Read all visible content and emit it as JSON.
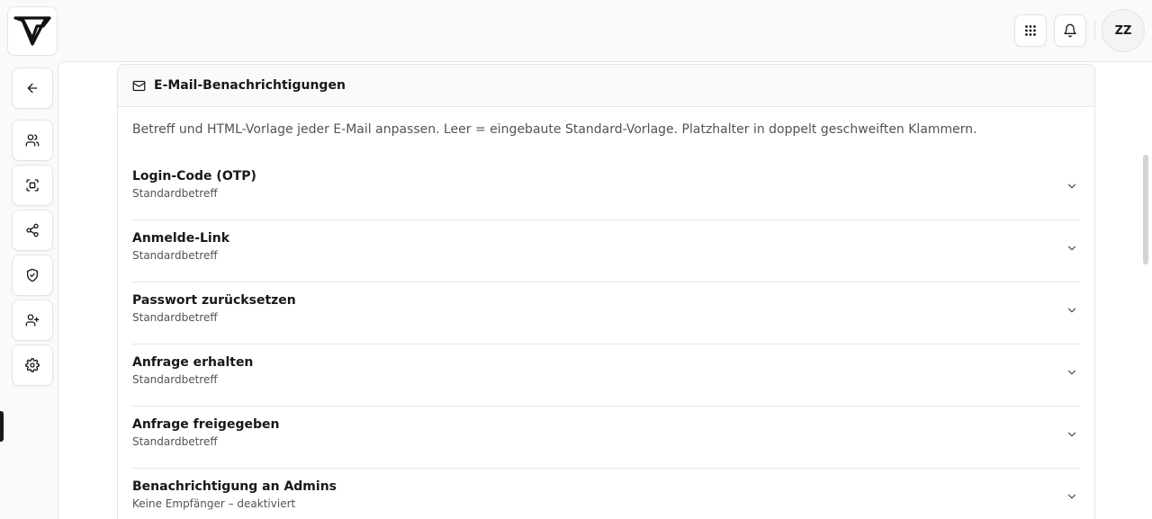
{
  "header": {
    "avatar_initials": "ZZ",
    "icons": [
      "apps-grid-icon",
      "bell-icon"
    ]
  },
  "sidebar": {
    "items": [
      {
        "name": "back",
        "icon": "arrow-left-icon"
      },
      {
        "name": "users",
        "icon": "users-icon"
      },
      {
        "name": "scan",
        "icon": "scan-face-icon"
      },
      {
        "name": "share",
        "icon": "share-icon"
      },
      {
        "name": "security",
        "icon": "shield-check-icon"
      },
      {
        "name": "add-user",
        "icon": "user-plus-icon"
      },
      {
        "name": "settings",
        "icon": "gear-icon",
        "active": true
      }
    ]
  },
  "card": {
    "title": "E-Mail-Benachrichtigungen",
    "title_icon": "mail-icon",
    "description": "Betreff und HTML-Vorlage jeder E-Mail anpassen. Leer = eingebaute Standard-Vorlage. Platzhalter in doppelt geschweiften Klammern.",
    "templates": [
      {
        "title": "Login-Code (OTP)",
        "subtitle": "Standardbetreff"
      },
      {
        "title": "Anmelde-Link",
        "subtitle": "Standardbetreff"
      },
      {
        "title": "Passwort zurücksetzen",
        "subtitle": "Standardbetreff"
      },
      {
        "title": "Anfrage erhalten",
        "subtitle": "Standardbetreff"
      },
      {
        "title": "Anfrage freigegeben",
        "subtitle": "Standardbetreff"
      },
      {
        "title": "Benachrichtigung an Admins",
        "subtitle": "Keine Empfänger – deaktiviert"
      }
    ]
  },
  "colors": {
    "background": "#fafafa",
    "border": "#e4e4e7",
    "text": "#18181b",
    "muted": "#52525b"
  }
}
